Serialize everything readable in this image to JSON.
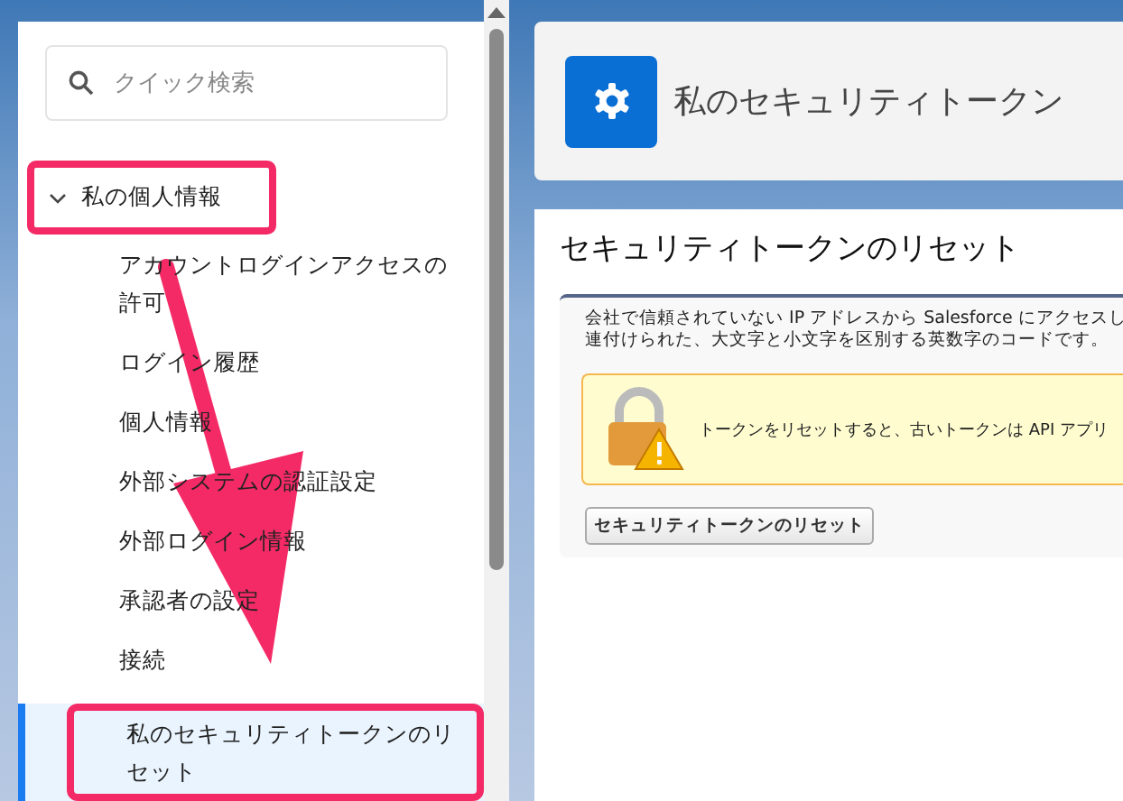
{
  "sidebar": {
    "search": {
      "placeholder": "クイック検索"
    },
    "tree": [
      {
        "label": "私の個人情報",
        "expanded": true,
        "highlighted": true,
        "children": [
          {
            "label": "アカウントログインアクセスの許可",
            "selected": false,
            "highlighted": false
          },
          {
            "label": "ログイン履歴",
            "selected": false,
            "highlighted": false
          },
          {
            "label": "個人情報",
            "selected": false,
            "highlighted": false
          },
          {
            "label": "外部システムの認証設定",
            "selected": false,
            "highlighted": false
          },
          {
            "label": "外部ログイン情報",
            "selected": false,
            "highlighted": false
          },
          {
            "label": "承認者の設定",
            "selected": false,
            "highlighted": false
          },
          {
            "label": "接続",
            "selected": false,
            "highlighted": false
          },
          {
            "label": "私のセキュリティトークンのリセット",
            "selected": true,
            "highlighted": true
          }
        ]
      }
    ]
  },
  "header": {
    "title": "私のセキュリティトークン"
  },
  "content": {
    "title": "セキュリティトークンのリセット",
    "description": [
      "会社で信頼されていない IP アドレスから Salesforce にアクセスし",
      "連付けられた、大文字と小文字を区別する英数字のコードです。"
    ],
    "warning": "トークンをリセットすると、古いトークンは API アプリ",
    "button": "セキュリティトークンのリセット"
  }
}
